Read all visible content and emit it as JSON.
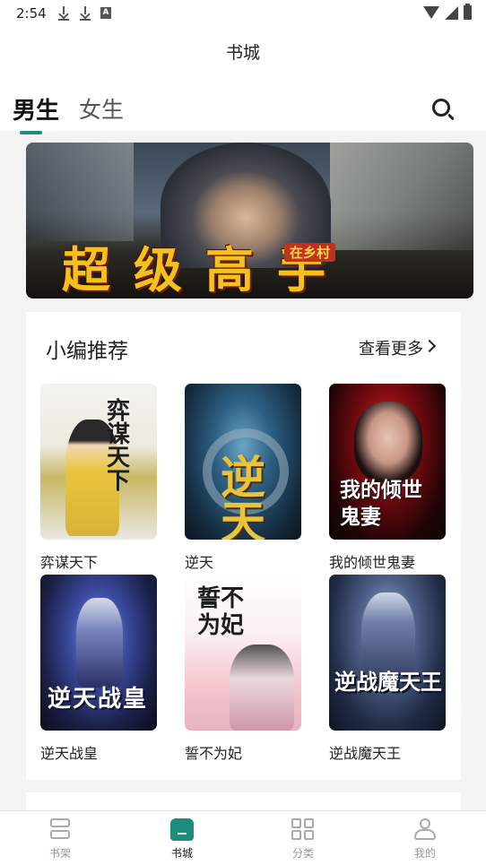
{
  "status_bar": {
    "time": "2:54"
  },
  "app_bar": {
    "title": "书城",
    "tabs": [
      {
        "label": "男生",
        "active": true
      },
      {
        "label": "女生",
        "active": false
      }
    ]
  },
  "banner": {
    "title": "超级高手",
    "subtitle": "在乡村"
  },
  "recommend": {
    "title": "小编推荐",
    "more": "查看更多",
    "books": [
      {
        "name": "弈谋天下",
        "cover_text": "弈谋天下"
      },
      {
        "name": "逆天",
        "cover_text": "逆天"
      },
      {
        "name": "我的倾世鬼妻",
        "cover_text": "我的倾世鬼妻"
      },
      {
        "name": "逆天战皇",
        "cover_text": "逆天战皇"
      },
      {
        "name": "誓不为妃",
        "cover_text": "誓不为妃"
      },
      {
        "name": "逆战魔天王",
        "cover_text": "逆战魔天王"
      }
    ]
  },
  "bottom_nav": [
    {
      "label": "书架",
      "icon": "bookshelf-icon",
      "active": false
    },
    {
      "label": "书城",
      "icon": "bookstore-icon",
      "active": true
    },
    {
      "label": "分类",
      "icon": "category-icon",
      "active": false
    },
    {
      "label": "我的",
      "icon": "profile-icon",
      "active": false
    }
  ],
  "colors": {
    "accent": "#1c8d7d"
  }
}
